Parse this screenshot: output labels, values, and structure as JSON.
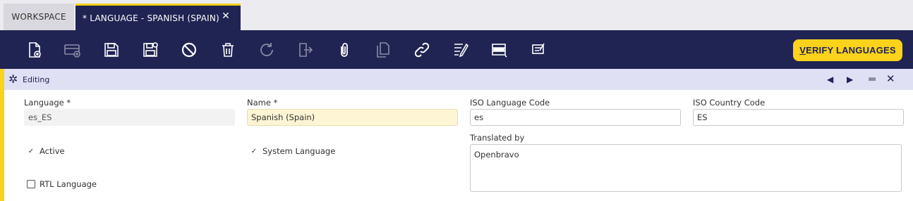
{
  "tabs": [
    {
      "label": "WORKSPACE"
    },
    {
      "label": "* LANGUAGE - SPANISH (SPAIN)",
      "close": "✕"
    }
  ],
  "toolbar": {
    "verify_prefix": "V",
    "verify_rest": "ERIFY LANGUAGES"
  },
  "status": {
    "text": "Editing"
  },
  "form": {
    "language": {
      "label": "Language *",
      "value": "es_ES"
    },
    "name": {
      "label": "Name *",
      "value": "Spanish (Spain)"
    },
    "iso_language": {
      "label": "ISO Language Code",
      "value": "es"
    },
    "iso_country": {
      "label": "ISO Country Code",
      "value": "ES"
    },
    "translated_by": {
      "label": "Translated by",
      "value": "Openbravo"
    },
    "active": {
      "label": "Active",
      "checked": true
    },
    "system_language": {
      "label": "System Language",
      "checked": true
    },
    "rtl_language": {
      "label": "RTL Language",
      "checked": false
    }
  },
  "colors": {
    "navy": "#202452",
    "accent_yellow": "#fcd21a",
    "status_bg": "#dfe0f3",
    "required_bg": "#fdf5d4"
  }
}
